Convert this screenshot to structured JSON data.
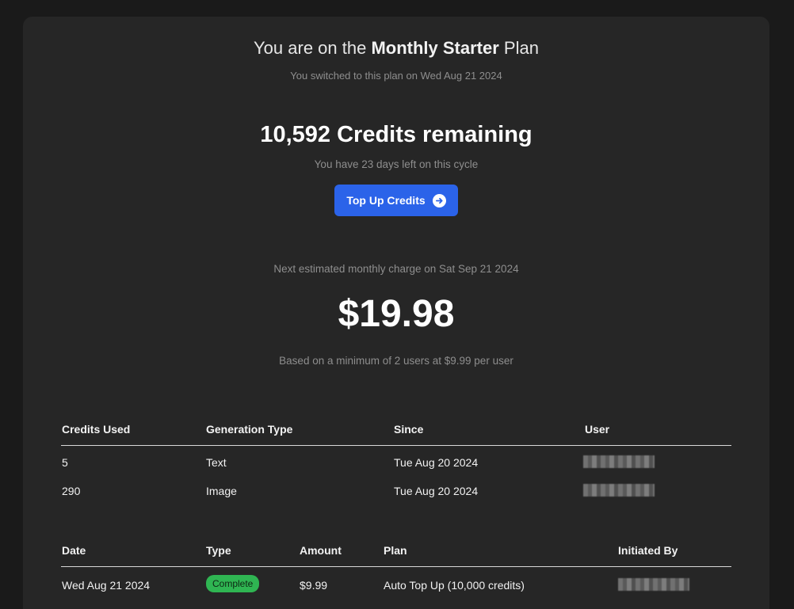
{
  "plan": {
    "title_prefix": "You are on the ",
    "plan_name": "Monthly Starter",
    "title_suffix": " Plan",
    "switched_text": "You switched to this plan on Wed Aug 21 2024"
  },
  "credits": {
    "remaining_title": "10,592 Credits remaining",
    "cycle_text": "You have 23 days left on this cycle",
    "topup_label": "Top Up Credits"
  },
  "billing": {
    "next_charge_text": "Next estimated monthly charge on Sat Sep 21 2024",
    "amount": "$19.98",
    "basis_text": "Based on a minimum of 2 users at $9.99 per user"
  },
  "usage_table": {
    "headers": [
      "Credits Used",
      "Generation Type",
      "Since",
      "User"
    ],
    "rows": [
      {
        "credits": "5",
        "type": "Text",
        "since": "Tue Aug 20 2024"
      },
      {
        "credits": "290",
        "type": "Image",
        "since": "Tue Aug 20 2024"
      }
    ]
  },
  "transactions_table": {
    "headers": [
      "Date",
      "Type",
      "Amount",
      "Plan",
      "Initiated By"
    ],
    "rows": [
      {
        "date": "Wed Aug 21 2024",
        "status": "Complete",
        "amount": "$9.99",
        "plan": "Auto Top Up (10,000 credits)"
      }
    ]
  },
  "colors": {
    "background": "#1a1a1a",
    "card": "#262626",
    "accent_button": "#2b63e9",
    "status_complete": "#2fb552",
    "muted_text": "#8e8e8e"
  },
  "icons": {
    "topup": "arrow-right-circle-icon"
  }
}
